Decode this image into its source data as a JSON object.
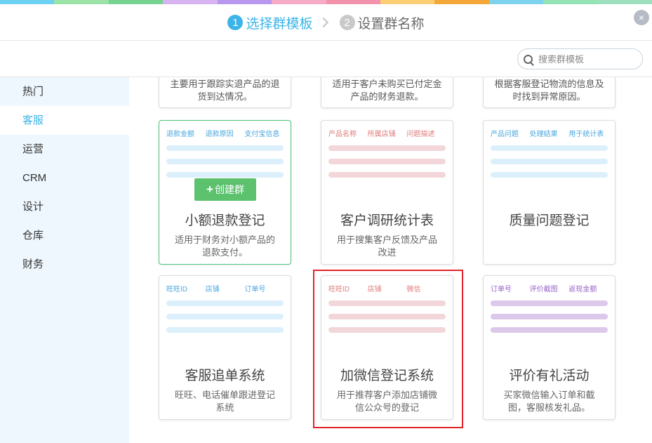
{
  "colors": {
    "stripe": [
      "#6dd2f2",
      "#9be3a6",
      "#77d392",
      "#d7b3f2",
      "#b798ec",
      "#f6aac5",
      "#f292ad",
      "#fdcf75",
      "#f5a83a",
      "#7dd2f0",
      "#95e3b4",
      "#9de0bd"
    ],
    "accent": "#3db4e8",
    "create": "#5cc26e",
    "highlight": "#e0242a"
  },
  "steps": [
    {
      "num": "1",
      "label": "选择群模板"
    },
    {
      "num": "2",
      "label": "设置群名称"
    }
  ],
  "close_icon": "×",
  "search": {
    "placeholder": "搜索群模板"
  },
  "sidebar": {
    "items": [
      {
        "label": "热门"
      },
      {
        "label": "客服"
      },
      {
        "label": "运营"
      },
      {
        "label": "CRM"
      },
      {
        "label": "设计"
      },
      {
        "label": "仓库"
      },
      {
        "label": "财务"
      }
    ]
  },
  "top_cards": [
    {
      "desc": "主要用于跟踪实退产品的退货到达情况。"
    },
    {
      "desc": "适用于客户未购买已付定金产品的财务退款。"
    },
    {
      "desc": "根据客服登记物流的信息及时找到异常原因。"
    }
  ],
  "cards": [
    {
      "fields": [
        "退款金额",
        "退款原因",
        "支付宝信息"
      ],
      "field_color": "#4aa7dd",
      "bar_color": "#dcf0fc",
      "title": "小额退款登记",
      "desc": "适用于财务对小额产品的退款支付。",
      "create": "创建群",
      "hover": true
    },
    {
      "fields": [
        "产品名称",
        "所属店铺",
        "问题描述"
      ],
      "field_color": "#e07a7a",
      "bar_color": "#f2d6d9",
      "title": "客户调研统计表",
      "desc": "用于搜集客户反馈及产品改进",
      "hover": false
    },
    {
      "fields": [
        "产品问题",
        "处理结果",
        "用于统计表"
      ],
      "field_color": "#4aa7dd",
      "bar_color": "#dcf0fc",
      "title": "质量问题登记",
      "desc": "",
      "hover": false
    },
    {
      "fields": [
        "旺旺ID",
        "店铺",
        "订单号"
      ],
      "field_color": "#4aa7dd",
      "bar_color": "#dcf0fc",
      "title": "客服追单系统",
      "desc": "旺旺、电话催单跟进登记系统",
      "hover": false
    },
    {
      "fields": [
        "旺旺ID",
        "店铺",
        "微信"
      ],
      "field_color": "#e07a7a",
      "bar_color": "#f2d6d9",
      "title": "加微信登记系统",
      "desc": "用于推荐客户添加店铺微信公众号的登记",
      "hover": false
    },
    {
      "fields": [
        "订单号",
        "评价截图",
        "返现金额"
      ],
      "field_color": "#9a63c8",
      "bar_color": "#dcc8ea",
      "title": "评价有礼活动",
      "desc": "买家微信输入订单和截图，客服核发礼品。",
      "hover": false
    }
  ]
}
